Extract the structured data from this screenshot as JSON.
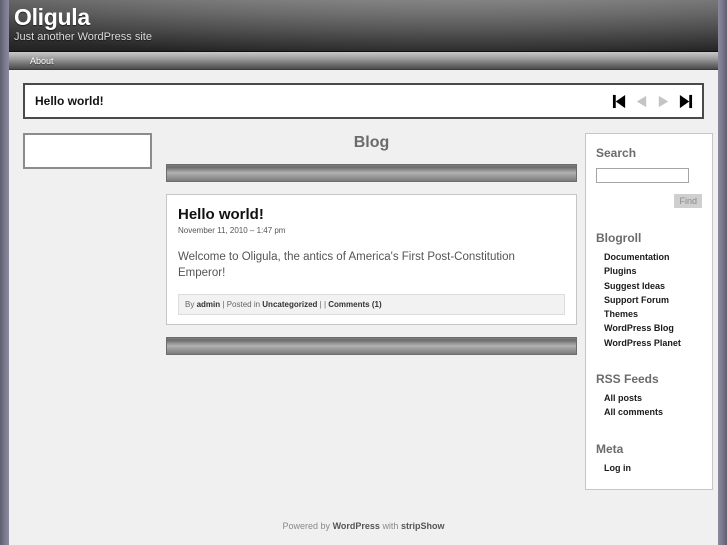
{
  "site": {
    "title": "Oligula",
    "description": "Just another WordPress site"
  },
  "nav": {
    "items": [
      {
        "label": "About"
      }
    ]
  },
  "stripshow": {
    "current_title": "Hello world!",
    "controls": [
      {
        "name": "first",
        "glyph": "first-icon",
        "enabled": true
      },
      {
        "name": "previous",
        "glyph": "previous-icon",
        "enabled": false
      },
      {
        "name": "next",
        "glyph": "next-icon",
        "enabled": false
      },
      {
        "name": "last",
        "glyph": "last-icon",
        "enabled": true
      }
    ]
  },
  "main": {
    "page_title": "Blog",
    "post": {
      "title": "Hello world!",
      "date": "November 11, 2010 – 1:47 pm",
      "body": "Welcome to Oligula, the antics of America's First Post-Constitution Emperor!",
      "meta": {
        "by_label": "By",
        "author": "admin",
        "sep1": "|",
        "posted_in_label": "Posted in",
        "category": "Uncategorized",
        "sep2": "|",
        "sep3": "|",
        "comments": "Comments (1)"
      }
    }
  },
  "sidebar": {
    "search": {
      "title": "Search",
      "value": "",
      "placeholder": "",
      "button_label": "Find"
    },
    "blogroll": {
      "title": "Blogroll",
      "links": [
        {
          "label": "Documentation"
        },
        {
          "label": "Plugins"
        },
        {
          "label": "Suggest Ideas"
        },
        {
          "label": "Support Forum"
        },
        {
          "label": "Themes"
        },
        {
          "label": "WordPress Blog"
        },
        {
          "label": "WordPress Planet"
        }
      ]
    },
    "rss": {
      "title": "RSS Feeds",
      "links": [
        {
          "label": "All posts"
        },
        {
          "label": "All comments"
        }
      ]
    },
    "meta": {
      "title": "Meta",
      "links": [
        {
          "label": "Log in"
        }
      ]
    }
  },
  "footer": {
    "prefix": "Powered by",
    "platform": "WordPress",
    "middle": "with",
    "theme": "stripShow"
  },
  "colors": {
    "page_background": "#f0f0f0",
    "header_dark": "#222222",
    "edge_purple": "#76768a",
    "accent_gray": "#6b6b6b"
  }
}
